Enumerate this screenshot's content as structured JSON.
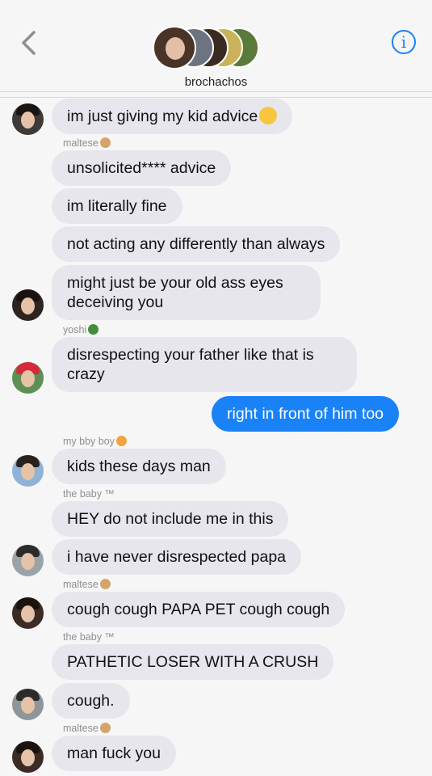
{
  "header": {
    "group_name": "brochachos",
    "back_icon": "chevron-left-icon",
    "info_icon": "info-icon",
    "info_glyph": "i",
    "accent_color": "#1a82f7"
  },
  "messages": [
    {
      "text": "im just giving my kid advice",
      "emoji": "pensive-face"
    },
    {
      "sender": "maltese",
      "sender_emoji": "dog-face",
      "text": "unsolicited**** advice"
    },
    {
      "text": "im literally fine"
    },
    {
      "text": "not acting any differently than always"
    },
    {
      "text": "might just be your old ass eyes deceiving you"
    },
    {
      "sender": "yoshi",
      "sender_emoji": "dinosaur",
      "text": "disrespecting your father like that is crazy"
    },
    {
      "text": "right in front of him too",
      "outgoing": true
    },
    {
      "sender": "my bby boy",
      "sender_emoji": "heart-eyes-face",
      "text": "kids these days man"
    },
    {
      "sender": "the baby ™",
      "text": "HEY do not include me in this"
    },
    {
      "text": "i have never disrespected papa"
    },
    {
      "sender": "maltese",
      "sender_emoji": "dog-face",
      "text": "cough cough PAPA PET cough cough"
    },
    {
      "sender": "the baby ™",
      "text": "PATHETIC LOSER WITH A CRUSH"
    },
    {
      "text": "cough."
    },
    {
      "sender": "maltese",
      "sender_emoji": "dog-face",
      "text": "man fuck you"
    }
  ]
}
